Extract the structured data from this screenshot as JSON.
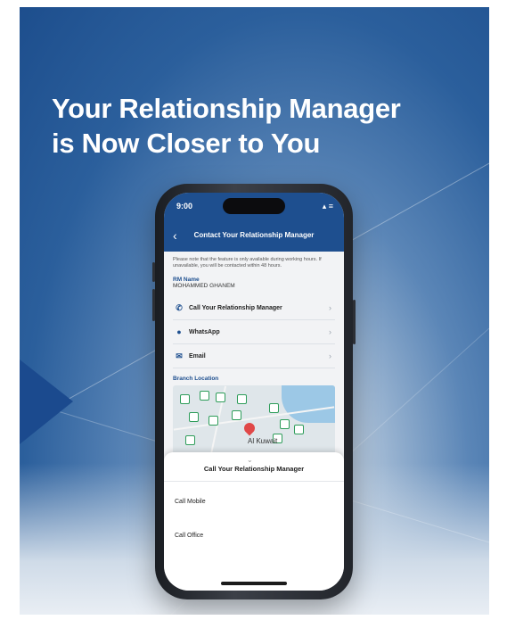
{
  "headline": {
    "line1": "Your Relationship Manager",
    "line2": "is Now Closer to You"
  },
  "status_bar": {
    "time": "9:00",
    "icons": "▴ ≡"
  },
  "nav": {
    "back_icon": "‹",
    "title": "Contact Your Relationship Manager"
  },
  "screen": {
    "note": "Please note that the feature is only available during working hours. If unavailable, you will be contacted within 48 hours.",
    "rm_label": "RM Name",
    "rm_value": "MOHAMMED GHANEM",
    "actions": [
      {
        "icon": "✆",
        "label": "Call Your Relationship Manager"
      },
      {
        "icon": "●",
        "label": "WhatsApp"
      },
      {
        "icon": "✉",
        "label": "Email"
      }
    ],
    "chevron": "›",
    "branch_label": "Branch Location",
    "map_label": "Al Kuwait"
  },
  "sheet": {
    "grabber": "⌄",
    "title": "Call Your Relationship Manager",
    "options": [
      "Call Mobile",
      "Call Office"
    ]
  },
  "colors": {
    "brand": "#1e4f8f",
    "accent_red": "#e04848",
    "pin_green": "#2e9d5a"
  }
}
